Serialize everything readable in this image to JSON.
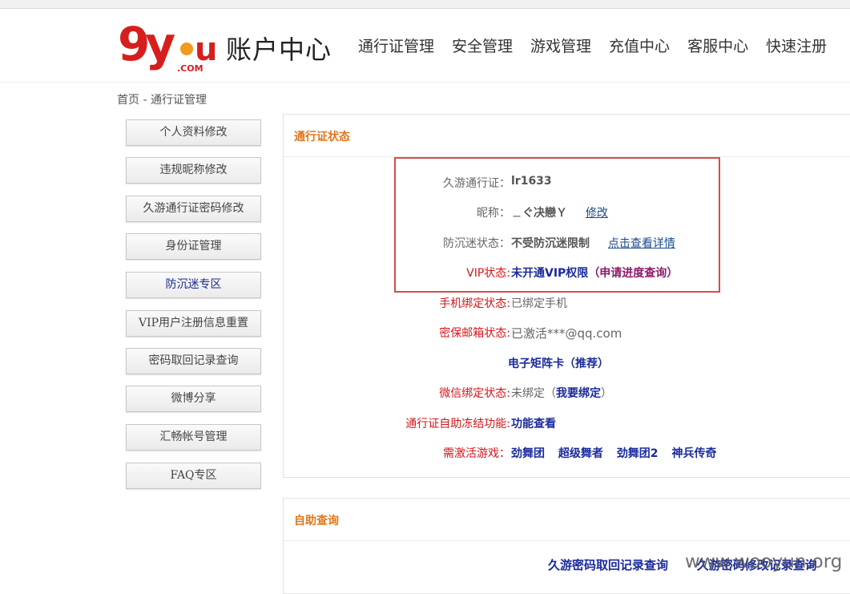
{
  "header": {
    "logo_text": "9you",
    "logo_sub": ".COM",
    "title": "账户中心",
    "nav": [
      "通行证管理",
      "安全管理",
      "游戏管理",
      "充值中心",
      "客服中心",
      "快速注册"
    ]
  },
  "breadcrumb": "首页 - 通行证管理",
  "sidebar": {
    "items": [
      {
        "label": "个人资料修改"
      },
      {
        "label": "违规昵称修改"
      },
      {
        "label": "久游通行证密码修改"
      },
      {
        "label": "身份证管理"
      },
      {
        "label": "防沉迷专区"
      },
      {
        "label": "VIP用户注册信息重置"
      },
      {
        "label": "密码取回记录查询"
      },
      {
        "label": "微博分享"
      },
      {
        "label": "汇畅帐号管理"
      },
      {
        "label": "FAQ专区"
      }
    ]
  },
  "status_panel": {
    "title": "通行证状态",
    "passport": {
      "label": "久游通行证：",
      "value": "lr1633"
    },
    "nickname": {
      "label": "昵称：",
      "value": "﹍ぐ决戀Ｙ",
      "action": "修改"
    },
    "anti_addiction": {
      "label": "防沉迷状态：",
      "value": "不受防沉迷限制",
      "action": "点击查看详情"
    },
    "vip": {
      "label": "VIP状态:",
      "value": "未开通VIP权限",
      "action": "（申请进度查询）"
    },
    "phone": {
      "label": "手机绑定状态:",
      "value": "已绑定手机"
    },
    "email": {
      "label": "密保邮箱状态:",
      "value": "已激活***@qq.com"
    },
    "matrix_card": "电子矩阵卡（推荐）",
    "wechat": {
      "label": "微信绑定状态:",
      "value_prefix": "未绑定（",
      "action": "我要绑定",
      "value_suffix": "）"
    },
    "freeze": {
      "label": "通行证自助冻结功能:",
      "action": "功能查看"
    },
    "games": {
      "label": "需激活游戏：",
      "items": [
        "劲舞团",
        "超级舞者",
        "劲舞团2",
        "神兵传奇"
      ]
    }
  },
  "self_service_panel": {
    "title": "自助查询",
    "links": [
      "久游密码取回记录查询",
      "久游密码修改记录查询"
    ]
  },
  "watermark": "www.wooyun.org"
}
